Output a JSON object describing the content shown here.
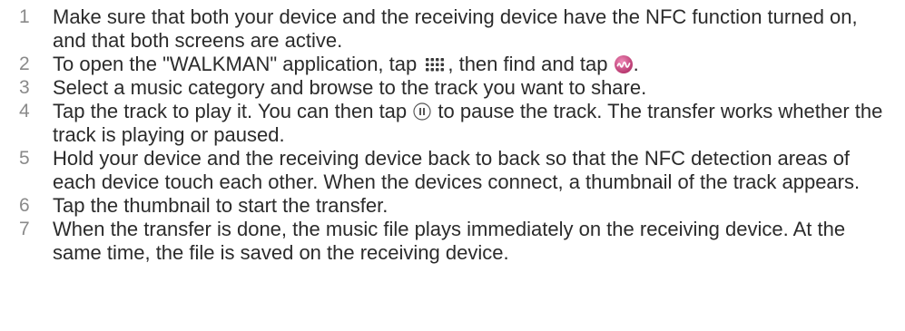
{
  "steps": [
    {
      "num": "1",
      "text": "Make sure that both your device and the receiving device have the NFC function turned on, and that both screens are active."
    },
    {
      "num": "2",
      "text_a": "To open the \"WALKMAN\" application, tap ",
      "icon_1": "apps-grid-icon",
      "text_b": ", then find and tap ",
      "icon_2": "walkman-app-icon",
      "text_c": "."
    },
    {
      "num": "3",
      "text": "Select a music category and browse to the track you want to share."
    },
    {
      "num": "4",
      "text_a": "Tap the track to play it. You can then tap ",
      "icon_1": "pause-icon",
      "text_b": " to pause the track. The transfer works whether the track is playing or paused."
    },
    {
      "num": "5",
      "text": "Hold your device and the receiving device back to back so that the NFC detection areas of each device touch each other. When the devices connect, a thumbnail of the track appears."
    },
    {
      "num": "6",
      "text": "Tap the thumbnail to start the transfer."
    },
    {
      "num": "7",
      "text": "When the transfer is done, the music file plays immediately on the receiving device. At the same time, the file is saved on the receiving device."
    }
  ],
  "colors": {
    "text": "#2b2b2b",
    "number": "#8a8a8a",
    "walkman_icon": "#c2417a"
  }
}
